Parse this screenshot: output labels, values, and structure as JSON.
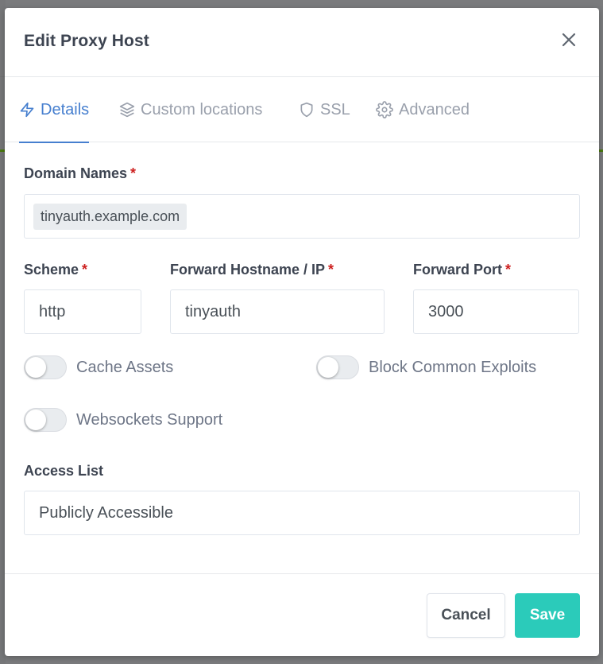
{
  "modal": {
    "title": "Edit Proxy Host",
    "close_icon": "close-icon"
  },
  "tabs": [
    {
      "label": "Details",
      "icon": "lightning-icon",
      "active": true
    },
    {
      "label": "Custom locations",
      "icon": "layers-icon",
      "active": false
    },
    {
      "label": "SSL",
      "icon": "shield-icon",
      "active": false
    },
    {
      "label": "Advanced",
      "icon": "gear-icon",
      "active": false
    }
  ],
  "form": {
    "domain_names": {
      "label": "Domain Names",
      "required_mark": "*",
      "values": [
        "tinyauth.example.com"
      ]
    },
    "scheme": {
      "label": "Scheme",
      "required_mark": "*",
      "value": "http"
    },
    "forward_host": {
      "label": "Forward Hostname / IP",
      "required_mark": "*",
      "value": "tinyauth"
    },
    "forward_port": {
      "label": "Forward Port",
      "required_mark": "*",
      "value": "3000"
    },
    "toggles": [
      {
        "label": "Cache Assets",
        "on": false
      },
      {
        "label": "Block Common Exploits",
        "on": false
      },
      {
        "label": "Websockets Support",
        "on": false
      }
    ],
    "access_list": {
      "label": "Access List",
      "value": "Publicly Accessible"
    }
  },
  "footer": {
    "cancel_label": "Cancel",
    "save_label": "Save"
  },
  "colors": {
    "accent": "#467fcf",
    "save": "#2bcbba",
    "required": "#cd201f"
  }
}
